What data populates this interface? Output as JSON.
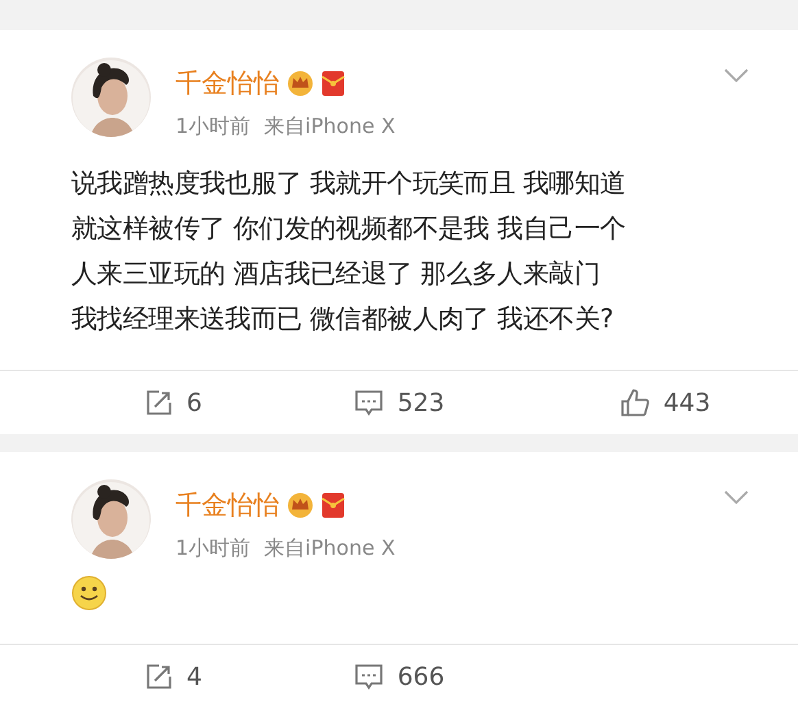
{
  "posts": [
    {
      "kind": "text",
      "author": "千金怡怡",
      "time": "1小时前",
      "source": "来自iPhone X",
      "text_lines": [
        "说我蹭热度我也服了 我就开个玩笑而且 我哪知道",
        "就这样被传了 你们发的视频都不是我 我自己一个",
        "人来三亚玩的 酒店我已经退了 那么多人来敲门",
        "我找经理来送我而已 微信都被人肉了 我还不关?"
      ],
      "stats": [
        {
          "kind": "repost",
          "count": "6"
        },
        {
          "kind": "comment",
          "count": "523"
        },
        {
          "kind": "like",
          "count": "443"
        }
      ]
    },
    {
      "author": "千金怡怡",
      "time": "1小时前",
      "source": "来自iPhone X",
      "kind": "emoji",
      "stats": [
        {
          "kind": "repost",
          "count": "4"
        },
        {
          "kind": "comment",
          "count": "666"
        }
      ]
    }
  ]
}
